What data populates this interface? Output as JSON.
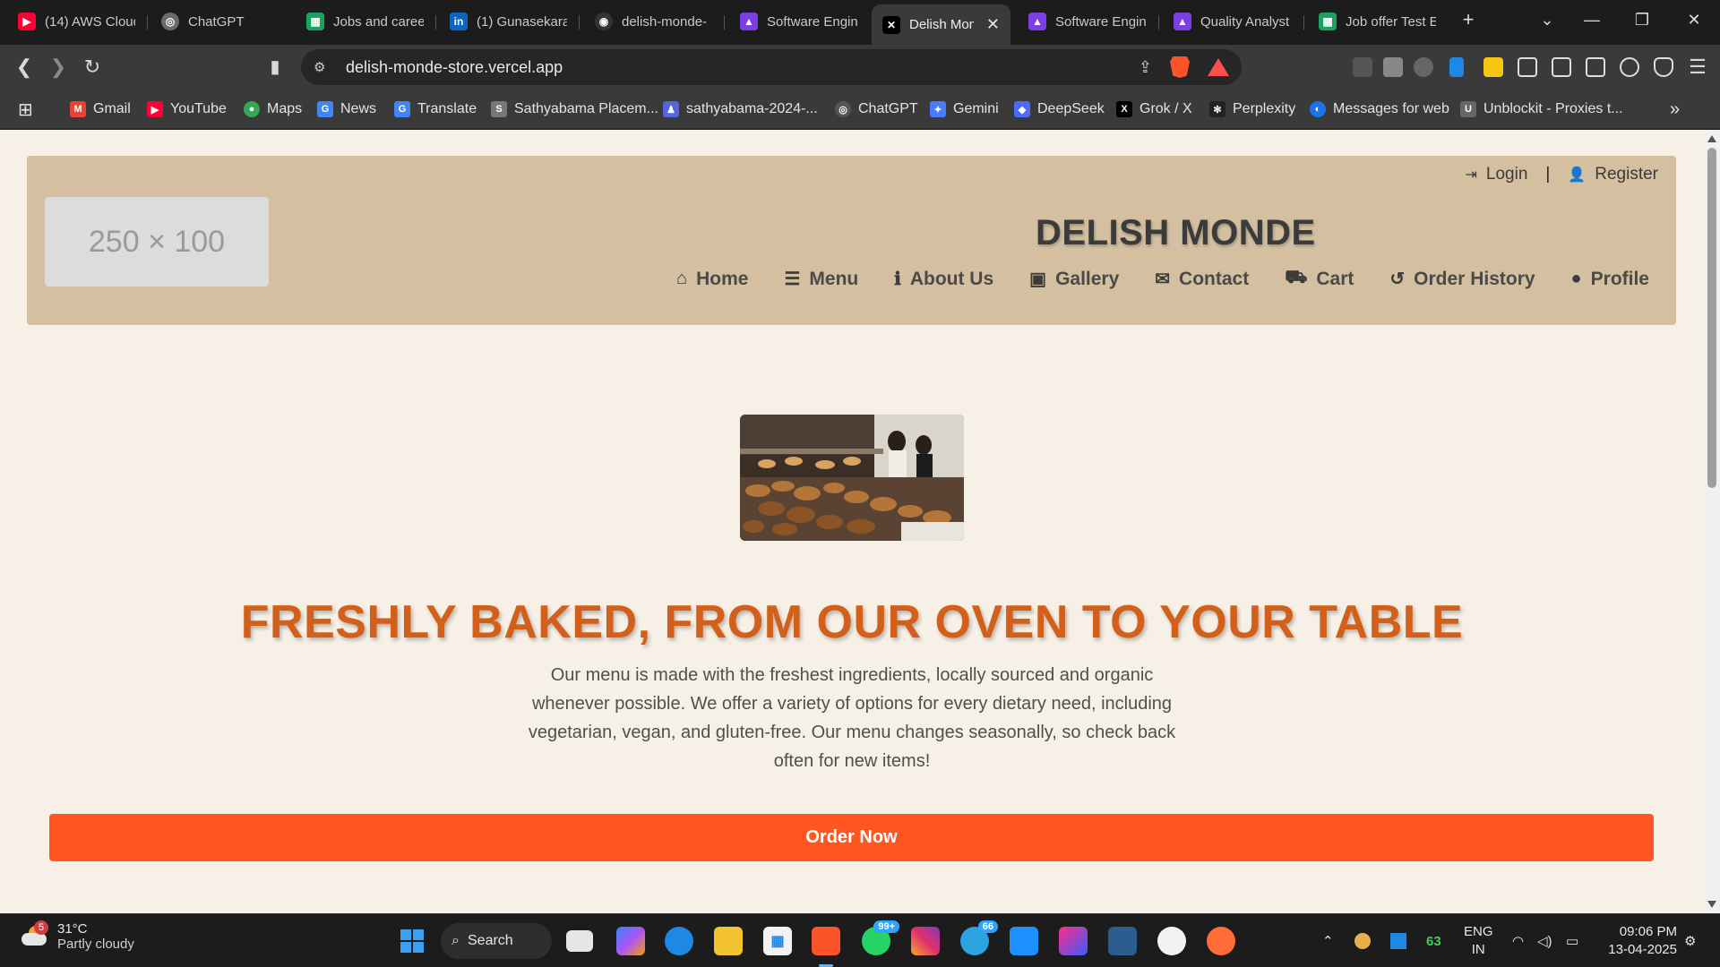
{
  "browser": {
    "tabs": [
      {
        "title": "(14) AWS Cloud",
        "color": "#ff0033",
        "glyph": "▶"
      },
      {
        "title": "ChatGPT",
        "color": "#6b6b6b",
        "glyph": "◎"
      },
      {
        "title": "Jobs and caree",
        "color": "#1aa260",
        "glyph": "▦"
      },
      {
        "title": "(1) Gunasekara",
        "color": "#0a66c2",
        "glyph": "in"
      },
      {
        "title": "delish-monde-",
        "color": "#333333",
        "glyph": "◉"
      },
      {
        "title": "Software Engin",
        "color": "#7b3fe4",
        "glyph": "▲"
      },
      {
        "title": "Delish Mon",
        "color": "#000000",
        "glyph": "✕"
      },
      {
        "title": "Software Engin",
        "color": "#7b3fe4",
        "glyph": "▲"
      },
      {
        "title": "Quality Analyst",
        "color": "#7b3fe4",
        "glyph": "▲"
      },
      {
        "title": "Job offer Test E",
        "color": "#1aa260",
        "glyph": "▦"
      }
    ],
    "new_tab": "+",
    "url": "delish-monde-store.vercel.app",
    "bookmarks": [
      {
        "label": "Gmail",
        "color": "#ea4335",
        "glyph": "M"
      },
      {
        "label": "YouTube",
        "color": "#ff0033",
        "glyph": "▶"
      },
      {
        "label": "Maps",
        "color": "#34a853",
        "glyph": "●"
      },
      {
        "label": "News",
        "color": "#4285f4",
        "glyph": "G"
      },
      {
        "label": "Translate",
        "color": "#4285f4",
        "glyph": "G"
      },
      {
        "label": "Sathyabama Placem...",
        "color": "#777777",
        "glyph": "S"
      },
      {
        "label": "sathyabama-2024-...",
        "color": "#5566dd",
        "glyph": "♟"
      },
      {
        "label": "ChatGPT",
        "color": "#555555",
        "glyph": "◎"
      },
      {
        "label": "Gemini",
        "color": "#4a7bff",
        "glyph": "✦"
      },
      {
        "label": "DeepSeek",
        "color": "#4d6bfe",
        "glyph": "◆"
      },
      {
        "label": "Grok / X",
        "color": "#000000",
        "glyph": "X"
      },
      {
        "label": "Perplexity",
        "color": "#222222",
        "glyph": "✻"
      },
      {
        "label": "Messages for web",
        "color": "#1a73e8",
        "glyph": "◐"
      },
      {
        "label": "Unblockit - Proxies t...",
        "color": "#666666",
        "glyph": "U"
      }
    ],
    "more_bookmarks": "»"
  },
  "site": {
    "logo_placeholder": "250 × 100",
    "brand": "DELISH MONDE",
    "auth": {
      "login": "Login",
      "separator": "|",
      "register": "Register"
    },
    "nav": [
      {
        "label": "Home",
        "icon": "home-icon",
        "glyph": "⌂"
      },
      {
        "label": "Menu",
        "icon": "list-icon",
        "glyph": "☰"
      },
      {
        "label": "About Us",
        "icon": "info-icon",
        "glyph": "ℹ"
      },
      {
        "label": "Gallery",
        "icon": "image-icon",
        "glyph": "▣"
      },
      {
        "label": "Contact",
        "icon": "envelope-icon",
        "glyph": "✉"
      },
      {
        "label": "Cart",
        "icon": "cart-icon",
        "glyph": "🛒"
      },
      {
        "label": "Order History",
        "icon": "history-icon",
        "glyph": "↺"
      },
      {
        "label": "Profile",
        "icon": "user-icon",
        "glyph": "👤"
      }
    ],
    "hero": {
      "title": "FRESHLY BAKED, FROM OUR OVEN TO YOUR TABLE",
      "description": "Our menu is made with the freshest ingredients, locally sourced and organic whenever possible. We offer a variety of options for every dietary need, including vegetarian, vegan, and gluten-free. Our menu changes seasonally, so check back often for new items!",
      "cta": "Order Now"
    },
    "colors": {
      "header_bg": "#d4c0a1",
      "page_bg": "#f7f0e6",
      "accent": "#ff5722",
      "title": "#d2601a"
    }
  },
  "taskbar": {
    "weather": {
      "temp": "31°C",
      "condition": "Partly cloudy",
      "badge": "5"
    },
    "search_label": "Search",
    "whatsapp_badge": "99+",
    "telegram_badge": "66",
    "tray_number": "63",
    "lang_1": "ENG",
    "lang_2": "IN",
    "time": "09:06 PM",
    "date": "13-04-2025"
  }
}
